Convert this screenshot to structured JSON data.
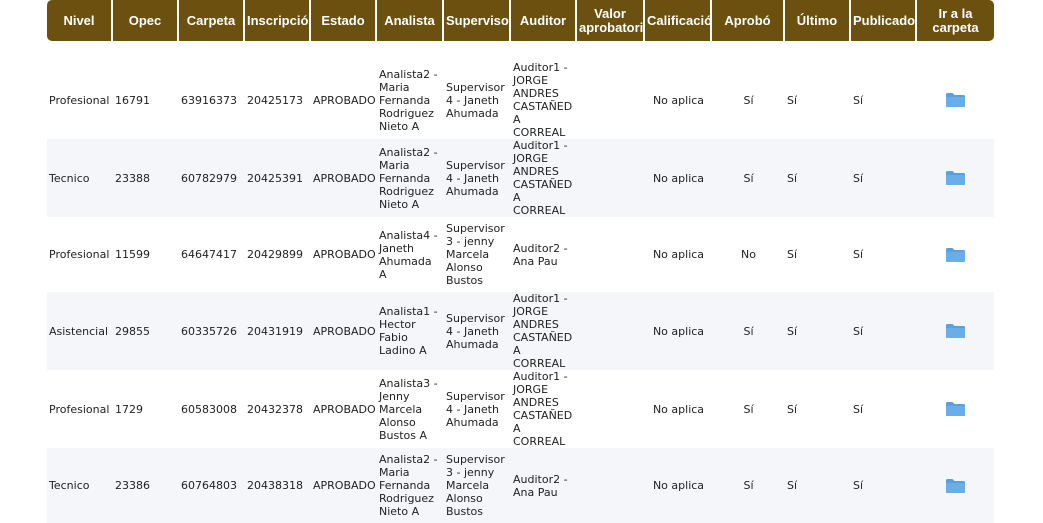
{
  "table": {
    "headers": [
      "Nivel",
      "Opec",
      "Carpeta",
      "Inscripción",
      "Estado",
      "Analista",
      "Supervisor",
      "Auditor",
      "Valor aprobatorio",
      "Calificación",
      "Aprobó",
      "Último",
      "Publicado",
      "Ir a la carpeta"
    ],
    "rows": [
      {
        "nivel": "Profesional",
        "opec": "16791",
        "carpeta": "63916373",
        "inscripcion": "20425173",
        "estado": "APROBADO",
        "analista": "Analista2 - Maria Fernanda Rodriguez Nieto A",
        "supervisor": "Supervisor4 - Janeth Ahumada",
        "auditor": "Auditor1 - JORGE ANDRES CASTAÑEDA CORREAL",
        "valor": "",
        "calificacion": "No aplica",
        "aprobo": "Sí",
        "ultimo": "Sí",
        "publicado": "Sí"
      },
      {
        "nivel": "Tecnico",
        "opec": "23388",
        "carpeta": "60782979",
        "inscripcion": "20425391",
        "estado": "APROBADO",
        "analista": "Analista2 - Maria Fernanda Rodriguez Nieto A",
        "supervisor": "Supervisor4 - Janeth Ahumada",
        "auditor": "Auditor1 - JORGE ANDRES CASTAÑEDA CORREAL",
        "valor": "",
        "calificacion": "No aplica",
        "aprobo": "Sí",
        "ultimo": "Sí",
        "publicado": "Sí"
      },
      {
        "nivel": "Profesional",
        "opec": "11599",
        "carpeta": "64647417",
        "inscripcion": "20429899",
        "estado": "APROBADO",
        "analista": "Analista4 - Janeth Ahumada A",
        "supervisor": "Supervisor3 - jenny Marcela Alonso Bustos",
        "auditor": "Auditor2 - Ana Pau",
        "valor": "",
        "calificacion": "No aplica",
        "aprobo": "No",
        "ultimo": "Sí",
        "publicado": "Sí"
      },
      {
        "nivel": "Asistencial",
        "opec": "29855",
        "carpeta": "60335726",
        "inscripcion": "20431919",
        "estado": "APROBADO",
        "analista": "Analista1 - Hector Fabio Ladino A",
        "supervisor": "Supervisor4 - Janeth Ahumada",
        "auditor": "Auditor1 - JORGE ANDRES CASTAÑEDA CORREAL",
        "valor": "",
        "calificacion": "No aplica",
        "aprobo": "Sí",
        "ultimo": "Sí",
        "publicado": "Sí"
      },
      {
        "nivel": "Profesional",
        "opec": "1729",
        "carpeta": "60583008",
        "inscripcion": "20432378",
        "estado": "APROBADO",
        "analista": "Analista3 - Jenny Marcela Alonso Bustos A",
        "supervisor": "Supervisor4 - Janeth Ahumada",
        "auditor": "Auditor1 - JORGE ANDRES CASTAÑEDA CORREAL",
        "valor": "",
        "calificacion": "No aplica",
        "aprobo": "Sí",
        "ultimo": "Sí",
        "publicado": "Sí"
      },
      {
        "nivel": "Tecnico",
        "opec": "23386",
        "carpeta": "60764803",
        "inscripcion": "20438318",
        "estado": "APROBADO",
        "analista": "Analista2 - Maria Fernanda Rodriguez Nieto A",
        "supervisor": "Supervisor3 - jenny Marcela Alonso Bustos",
        "auditor": "Auditor2 - Ana Pau",
        "valor": "",
        "calificacion": "No aplica",
        "aprobo": "Sí",
        "ultimo": "Sí",
        "publicado": "Sí"
      }
    ],
    "folder_icon": "folder-icon",
    "colors": {
      "header_bg": "#6b5010",
      "header_text": "#ffffff",
      "row_alt": "#f4f6fa",
      "folder": "#5aa0e0"
    }
  }
}
